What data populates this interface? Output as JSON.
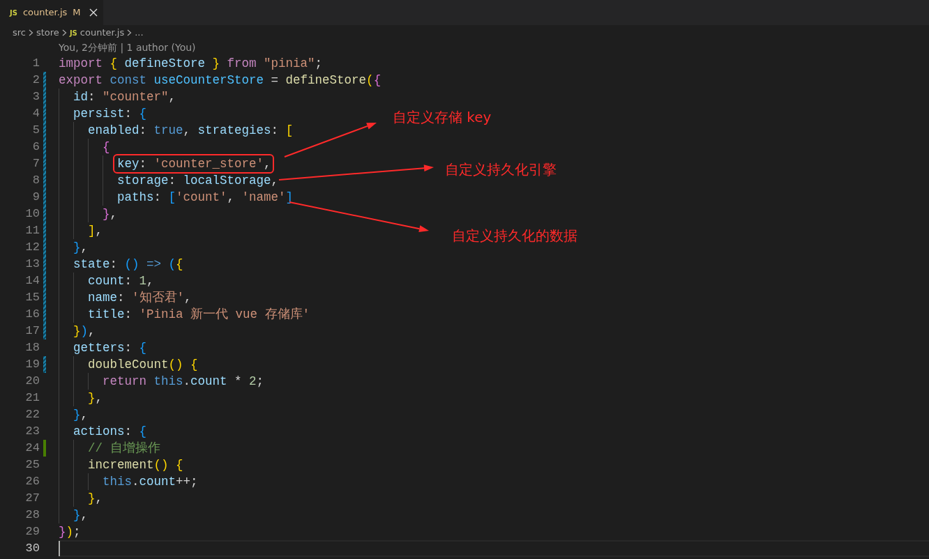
{
  "tab": {
    "icon_text": "JS",
    "label": "counter.js",
    "status": "M",
    "selected": true
  },
  "breadcrumb": [
    {
      "label": "src"
    },
    {
      "label": "store"
    },
    {
      "icon_text": "JS",
      "label": "counter.js"
    },
    {
      "label": "..."
    }
  ],
  "blame": "You, 2分钟前 | 1 author (You)",
  "lines": [
    {
      "number": "1",
      "kind": "unchanged",
      "current": false,
      "tokens": [
        {
          "kind": "kw",
          "text": "import "
        },
        {
          "kind": "b1",
          "text": "{ "
        },
        {
          "kind": "v",
          "text": "defineStore "
        },
        {
          "kind": "b1",
          "text": "} "
        },
        {
          "kind": "kw",
          "text": "from "
        },
        {
          "kind": "s",
          "text": "\"pinia\""
        },
        {
          "kind": "p",
          "text": ";"
        }
      ]
    },
    {
      "number": "2",
      "kind": "modified",
      "current": false,
      "tokens": [
        {
          "kind": "kw",
          "text": "export "
        },
        {
          "kind": "st",
          "text": "const "
        },
        {
          "kind": "cv",
          "text": "useCounterStore "
        },
        {
          "kind": "p",
          "text": "= "
        },
        {
          "kind": "fn",
          "text": "defineStore"
        },
        {
          "kind": "b1",
          "text": "("
        },
        {
          "kind": "b2",
          "text": "{"
        }
      ]
    },
    {
      "number": "3",
      "kind": "modified",
      "current": false,
      "tokens": [
        {
          "kind": "v",
          "text": "  id"
        },
        {
          "kind": "p",
          "text": ": "
        },
        {
          "kind": "s",
          "text": "\"counter\""
        },
        {
          "kind": "p",
          "text": ","
        }
      ]
    },
    {
      "number": "4",
      "kind": "modified",
      "current": false,
      "tokens": [
        {
          "kind": "v",
          "text": "  persist"
        },
        {
          "kind": "p",
          "text": ": "
        },
        {
          "kind": "b3",
          "text": "{"
        }
      ]
    },
    {
      "number": "5",
      "kind": "modified",
      "current": false,
      "tokens": [
        {
          "kind": "v",
          "text": "    enabled"
        },
        {
          "kind": "p",
          "text": ": "
        },
        {
          "kind": "st",
          "text": "true"
        },
        {
          "kind": "p",
          "text": ", "
        },
        {
          "kind": "v",
          "text": "strategies"
        },
        {
          "kind": "p",
          "text": ": "
        },
        {
          "kind": "b1",
          "text": "["
        }
      ]
    },
    {
      "number": "6",
      "kind": "modified",
      "current": false,
      "tokens": [
        {
          "kind": "b2",
          "text": "      {"
        }
      ]
    },
    {
      "number": "7",
      "kind": "modified",
      "current": false,
      "boxed": true,
      "tokens": [
        {
          "kind": "v",
          "text": "        key"
        },
        {
          "kind": "p",
          "text": ": "
        },
        {
          "kind": "s",
          "text": "'counter_store'"
        },
        {
          "kind": "p",
          "text": ","
        }
      ]
    },
    {
      "number": "8",
      "kind": "modified",
      "current": false,
      "tokens": [
        {
          "kind": "v",
          "text": "        storage"
        },
        {
          "kind": "p",
          "text": ": "
        },
        {
          "kind": "v",
          "text": "localStorage"
        },
        {
          "kind": "p",
          "text": ","
        }
      ]
    },
    {
      "number": "9",
      "kind": "modified",
      "current": false,
      "tokens": [
        {
          "kind": "v",
          "text": "        paths"
        },
        {
          "kind": "p",
          "text": ": "
        },
        {
          "kind": "b3",
          "text": "["
        },
        {
          "kind": "s",
          "text": "'count'"
        },
        {
          "kind": "p",
          "text": ", "
        },
        {
          "kind": "s",
          "text": "'name'"
        },
        {
          "kind": "b3",
          "text": "]"
        }
      ]
    },
    {
      "number": "10",
      "kind": "modified",
      "current": false,
      "tokens": [
        {
          "kind": "b2",
          "text": "      }"
        },
        {
          "kind": "p",
          "text": ","
        }
      ]
    },
    {
      "number": "11",
      "kind": "modified",
      "current": false,
      "tokens": [
        {
          "kind": "b1",
          "text": "    ]"
        },
        {
          "kind": "p",
          "text": ","
        }
      ]
    },
    {
      "number": "12",
      "kind": "modified",
      "current": false,
      "tokens": [
        {
          "kind": "b3",
          "text": "  }"
        },
        {
          "kind": "p",
          "text": ","
        }
      ]
    },
    {
      "number": "13",
      "kind": "modified",
      "current": false,
      "tokens": [
        {
          "kind": "v",
          "text": "  state"
        },
        {
          "kind": "p",
          "text": ": "
        },
        {
          "kind": "b3",
          "text": "() "
        },
        {
          "kind": "st",
          "text": "=> "
        },
        {
          "kind": "b3",
          "text": "("
        },
        {
          "kind": "b1",
          "text": "{"
        }
      ]
    },
    {
      "number": "14",
      "kind": "modified",
      "current": false,
      "tokens": [
        {
          "kind": "v",
          "text": "    count"
        },
        {
          "kind": "p",
          "text": ": "
        },
        {
          "kind": "n",
          "text": "1"
        },
        {
          "kind": "p",
          "text": ","
        }
      ]
    },
    {
      "number": "15",
      "kind": "modified",
      "current": false,
      "tokens": [
        {
          "kind": "v",
          "text": "    name"
        },
        {
          "kind": "p",
          "text": ": "
        },
        {
          "kind": "s",
          "text": "'知否君'"
        },
        {
          "kind": "p",
          "text": ","
        }
      ]
    },
    {
      "number": "16",
      "kind": "modified",
      "current": false,
      "tokens": [
        {
          "kind": "v",
          "text": "    title"
        },
        {
          "kind": "p",
          "text": ": "
        },
        {
          "kind": "s",
          "text": "'Pinia 新一代 vue 存储库'"
        }
      ]
    },
    {
      "number": "17",
      "kind": "modified",
      "current": false,
      "tokens": [
        {
          "kind": "b1",
          "text": "  }"
        },
        {
          "kind": "b3",
          "text": ")"
        },
        {
          "kind": "p",
          "text": ","
        }
      ]
    },
    {
      "number": "18",
      "kind": "unchanged",
      "current": false,
      "tokens": [
        {
          "kind": "v",
          "text": "  getters"
        },
        {
          "kind": "p",
          "text": ": "
        },
        {
          "kind": "b3",
          "text": "{"
        }
      ]
    },
    {
      "number": "19",
      "kind": "modified",
      "current": false,
      "tokens": [
        {
          "kind": "fn",
          "text": "    doubleCount"
        },
        {
          "kind": "b1",
          "text": "() {"
        }
      ]
    },
    {
      "number": "20",
      "kind": "unchanged",
      "current": false,
      "tokens": [
        {
          "kind": "kw",
          "text": "      return "
        },
        {
          "kind": "st",
          "text": "this"
        },
        {
          "kind": "p",
          "text": "."
        },
        {
          "kind": "v",
          "text": "count "
        },
        {
          "kind": "p",
          "text": "* "
        },
        {
          "kind": "n",
          "text": "2"
        },
        {
          "kind": "p",
          "text": ";"
        }
      ]
    },
    {
      "number": "21",
      "kind": "unchanged",
      "current": false,
      "tokens": [
        {
          "kind": "b1",
          "text": "    }"
        },
        {
          "kind": "p",
          "text": ","
        }
      ]
    },
    {
      "number": "22",
      "kind": "unchanged",
      "current": false,
      "tokens": [
        {
          "kind": "b3",
          "text": "  }"
        },
        {
          "kind": "p",
          "text": ","
        }
      ]
    },
    {
      "number": "23",
      "kind": "unchanged",
      "current": false,
      "tokens": [
        {
          "kind": "v",
          "text": "  actions"
        },
        {
          "kind": "p",
          "text": ": "
        },
        {
          "kind": "b3",
          "text": "{"
        }
      ]
    },
    {
      "number": "24",
      "kind": "added",
      "current": false,
      "tokens": [
        {
          "kind": "c",
          "text": "    // 自增操作"
        }
      ]
    },
    {
      "number": "25",
      "kind": "unchanged",
      "current": false,
      "tokens": [
        {
          "kind": "fn",
          "text": "    increment"
        },
        {
          "kind": "b1",
          "text": "() {"
        }
      ]
    },
    {
      "number": "26",
      "kind": "unchanged",
      "current": false,
      "tokens": [
        {
          "kind": "st",
          "text": "      this"
        },
        {
          "kind": "p",
          "text": "."
        },
        {
          "kind": "v",
          "text": "count"
        },
        {
          "kind": "p",
          "text": "++;"
        }
      ]
    },
    {
      "number": "27",
      "kind": "unchanged",
      "current": false,
      "tokens": [
        {
          "kind": "b1",
          "text": "    }"
        },
        {
          "kind": "p",
          "text": ","
        }
      ]
    },
    {
      "number": "28",
      "kind": "unchanged",
      "current": false,
      "tokens": [
        {
          "kind": "b3",
          "text": "  }"
        },
        {
          "kind": "p",
          "text": ","
        }
      ]
    },
    {
      "number": "29",
      "kind": "unchanged",
      "current": false,
      "tokens": [
        {
          "kind": "b2",
          "text": "}"
        },
        {
          "kind": "b1",
          "text": ")"
        },
        {
          "kind": "p",
          "text": ";"
        }
      ]
    },
    {
      "number": "30",
      "kind": "unchanged",
      "current": true
    }
  ],
  "annotations": [
    {
      "text": "自定义存储 key"
    },
    {
      "text": "自定义持久化引擎"
    },
    {
      "text": "自定义持久化的数据"
    }
  ]
}
